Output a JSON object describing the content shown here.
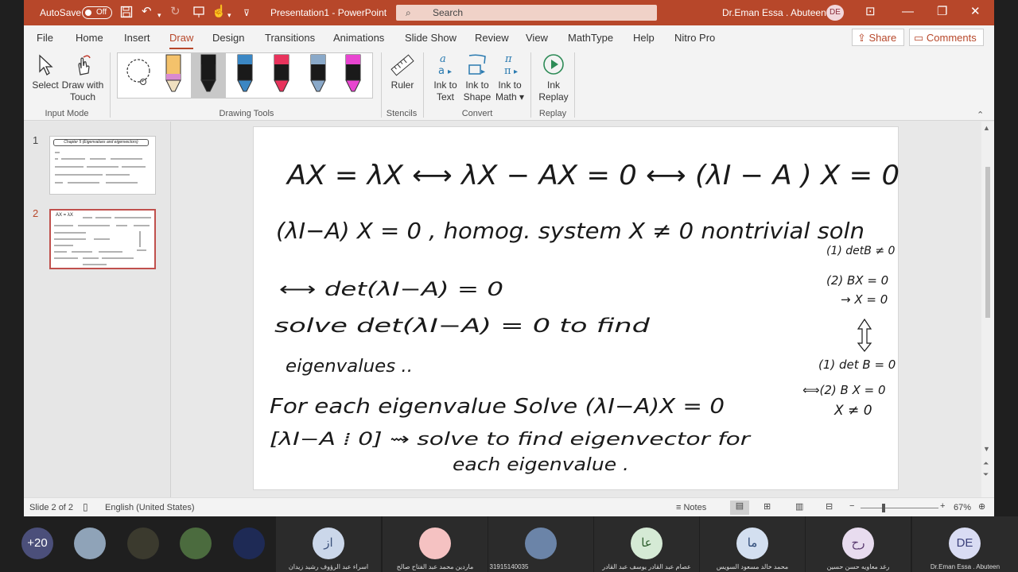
{
  "titlebar": {
    "autosave_label": "AutoSave",
    "autosave_state": "Off",
    "document_title": "Presentation1  -  PowerPoint",
    "search_placeholder": "Search",
    "user_name": "Dr.Eman  Essa . Abuteen",
    "user_initials": "DE",
    "color": "#b7472a"
  },
  "tabs": [
    "File",
    "Home",
    "Insert",
    "Draw",
    "Design",
    "Transitions",
    "Animations",
    "Slide Show",
    "Review",
    "View",
    "MathType",
    "Help",
    "Nitro Pro"
  ],
  "active_tab": "Draw",
  "share_label": "Share",
  "comments_label": "Comments",
  "ribbon": {
    "input_mode": {
      "select": "Select",
      "draw_touch_1": "Draw with",
      "draw_touch_2": "Touch",
      "group": "Input Mode"
    },
    "drawing_tools_group": "Drawing Tools",
    "stencils": {
      "ruler": "Ruler",
      "group": "Stencils"
    },
    "convert": {
      "ink_text_1": "Ink to",
      "ink_text_2": "Text",
      "ink_shape_1": "Ink to",
      "ink_shape_2": "Shape",
      "ink_math_1": "Ink to",
      "ink_math_2": "Math",
      "group": "Convert"
    },
    "replay": {
      "ink_replay_1": "Ink",
      "ink_replay_2": "Replay",
      "group": "Replay"
    },
    "pen_colors": [
      "#f4c26b",
      "#1a1a1a",
      "#3b87c4",
      "#e8335c",
      "#8aa9c9",
      "#e845d0"
    ]
  },
  "thumbnails": [
    {
      "number": "1",
      "title": "Chapter 5 (Eigenvalues and eigenvectors)"
    },
    {
      "number": "2",
      "title": "AX = λX"
    }
  ],
  "slide_ink": {
    "line1": "AX = λX   ⟷   λX − AX = 0   ⟷  (λI − A ) X = 0",
    "line2": "(λI−A) X = 0   ,  homog. system   X ≠ 0   nontrivial soln",
    "line3": "⟷   det(λI−A) = 0",
    "line4": "solve   det(λI−A) = 0   to   find",
    "line5": "eigenvalues ..",
    "line6": "For  each  eigenvalue      Solve  (λI−A)X = 0",
    "line7": "[λI−A ⁞ 0]   ⇝ solve   to  find eigenvector  for",
    "line8": "each  eigenvalue .",
    "side1": "(1) detB ≠ 0",
    "side2": "(2) BX = 0",
    "side3": "→ X = 0",
    "side4": "(1) det B = 0",
    "side5": "⟺(2) B X = 0",
    "side6": "X ≠ 0"
  },
  "status": {
    "slide_of": "Slide 2 of 2",
    "language": "English (United States)",
    "notes": "Notes",
    "zoom": "67%"
  },
  "meeting": {
    "overflow_count": "+20",
    "participants": [
      {
        "initials": "از",
        "name": "اسراء عبد الرؤوف رشيد زيدان",
        "bg": "#cbd7ea",
        "fg": "#3a4f7a"
      },
      {
        "initials": "",
        "name": "ماردين محمد عبد الفتاح صالح",
        "bg": "#f5c2c2",
        "fg": "#7a3030"
      },
      {
        "initials": "",
        "name": "31915140035",
        "bg": "#6b84a8",
        "fg": "#ffffff"
      },
      {
        "initials": "عا",
        "name": "عصام عبد القادر يوسف عبد القادر",
        "bg": "#d5ead5",
        "fg": "#2e5e2e"
      },
      {
        "initials": "ما",
        "name": "محمد خالد مسعود السويس",
        "bg": "#d3dff0",
        "fg": "#2e4a78"
      },
      {
        "initials": "رح",
        "name": "رغد معاويه حسن حسين",
        "bg": "#e8dcef",
        "fg": "#5a3b70"
      },
      {
        "initials": "DE",
        "name": "Dr.Eman  Essa . Abuteen",
        "bg": "#d9dcf3",
        "fg": "#3a3f7a"
      }
    ]
  }
}
